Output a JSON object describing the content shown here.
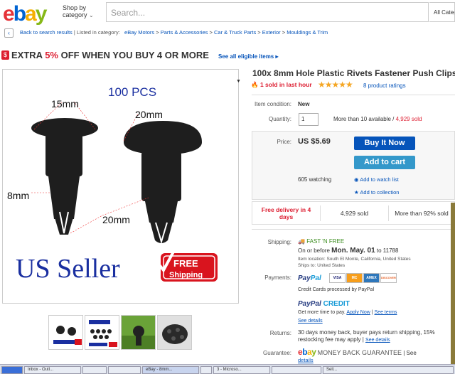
{
  "header": {
    "logo_letters": [
      "e",
      "b",
      "a",
      "y"
    ],
    "logo_colors": [
      "#e53238",
      "#0064d2",
      "#f5af02",
      "#86b817"
    ],
    "shop_by_line1": "Shop by",
    "shop_by_line2": "category",
    "search_placeholder": "Search...",
    "all_categories": "All Categ"
  },
  "breadcrumb": {
    "back": "Back to search results",
    "listed_in": "| Listed in category:",
    "items": [
      "eBay Motors",
      "Parts & Accessories",
      "Car & Truck Parts",
      "Exterior",
      "Mouldings & Trim"
    ],
    "separator": ">"
  },
  "promo": {
    "prefix": "EXTRA ",
    "percent": "5%",
    "suffix": " OFF WHEN YOU BUY 4 OR MORE",
    "link": "See all eligible items",
    "link_arrow": "▸"
  },
  "image": {
    "count_label": "100 PCS",
    "dim_top_left": "15mm",
    "dim_top_right": "20mm",
    "dim_left": "8mm",
    "dim_bottom": "20mm",
    "seller_text": "US Seller",
    "free_line1": "FREE",
    "free_line2": "Shipping"
  },
  "listing": {
    "title": "100x 8mm Hole Plastic Rivets Fastener Push Clips",
    "sold_last_hour": "1 sold in last hour",
    "stars": "★★★★★",
    "rating_count": "8 product ratings",
    "condition_label": "Item condition:",
    "condition_value": "New",
    "quantity_label": "Quantity:",
    "quantity_value": "1",
    "available": "More than 10 available / ",
    "sold_count": "4,929 sold",
    "price_label": "Price:",
    "price": "US $5.69",
    "buy_now": "Buy It Now",
    "add_to_cart": "Add to cart",
    "watching": "605 watching",
    "add_watch": "Add to watch list",
    "add_collection": "Add to collection",
    "delivery": "Free delivery in 4 days",
    "sold_box": "4,929 sold",
    "more_sold": "More than 92% sold"
  },
  "shipping": {
    "label": "Shipping:",
    "fast_free": "FAST 'N FREE",
    "on_before": "On or before ",
    "date": "Mon. May. 01",
    "to": " to 11788",
    "item_location": "Item location:  South El Monte, California, United States",
    "ships_to": "Ships to:  United States"
  },
  "payments": {
    "label": "Payments:",
    "paypal_1": "Pay",
    "paypal_2": "Pal",
    "cards": [
      "VISA",
      "MC",
      "AMEX",
      "DISCOVER"
    ],
    "credit_processed": "Credit Cards processed by PayPal",
    "pp_credit_1": "PayPal",
    "pp_credit_2": " CREDIT",
    "get_more_time": "Get more time to pay. ",
    "apply_now": "Apply Now",
    "see_terms": "See terms",
    "see_details": "See details"
  },
  "returns": {
    "label": "Returns:",
    "text": "30 days money back, buyer pays return shipping, 15% restocking fee may apply",
    "see_details": "See details"
  },
  "guarantee": {
    "label": "Guarantee:",
    "text": "MONEY BACK GUARANTEE",
    "see": "| See",
    "details": "details"
  },
  "taskbar": {
    "items": [
      "Inbox - Outl...",
      "",
      "",
      "eBay - 8mm...",
      "",
      "3 - Microso...",
      "",
      "Sell..."
    ]
  }
}
